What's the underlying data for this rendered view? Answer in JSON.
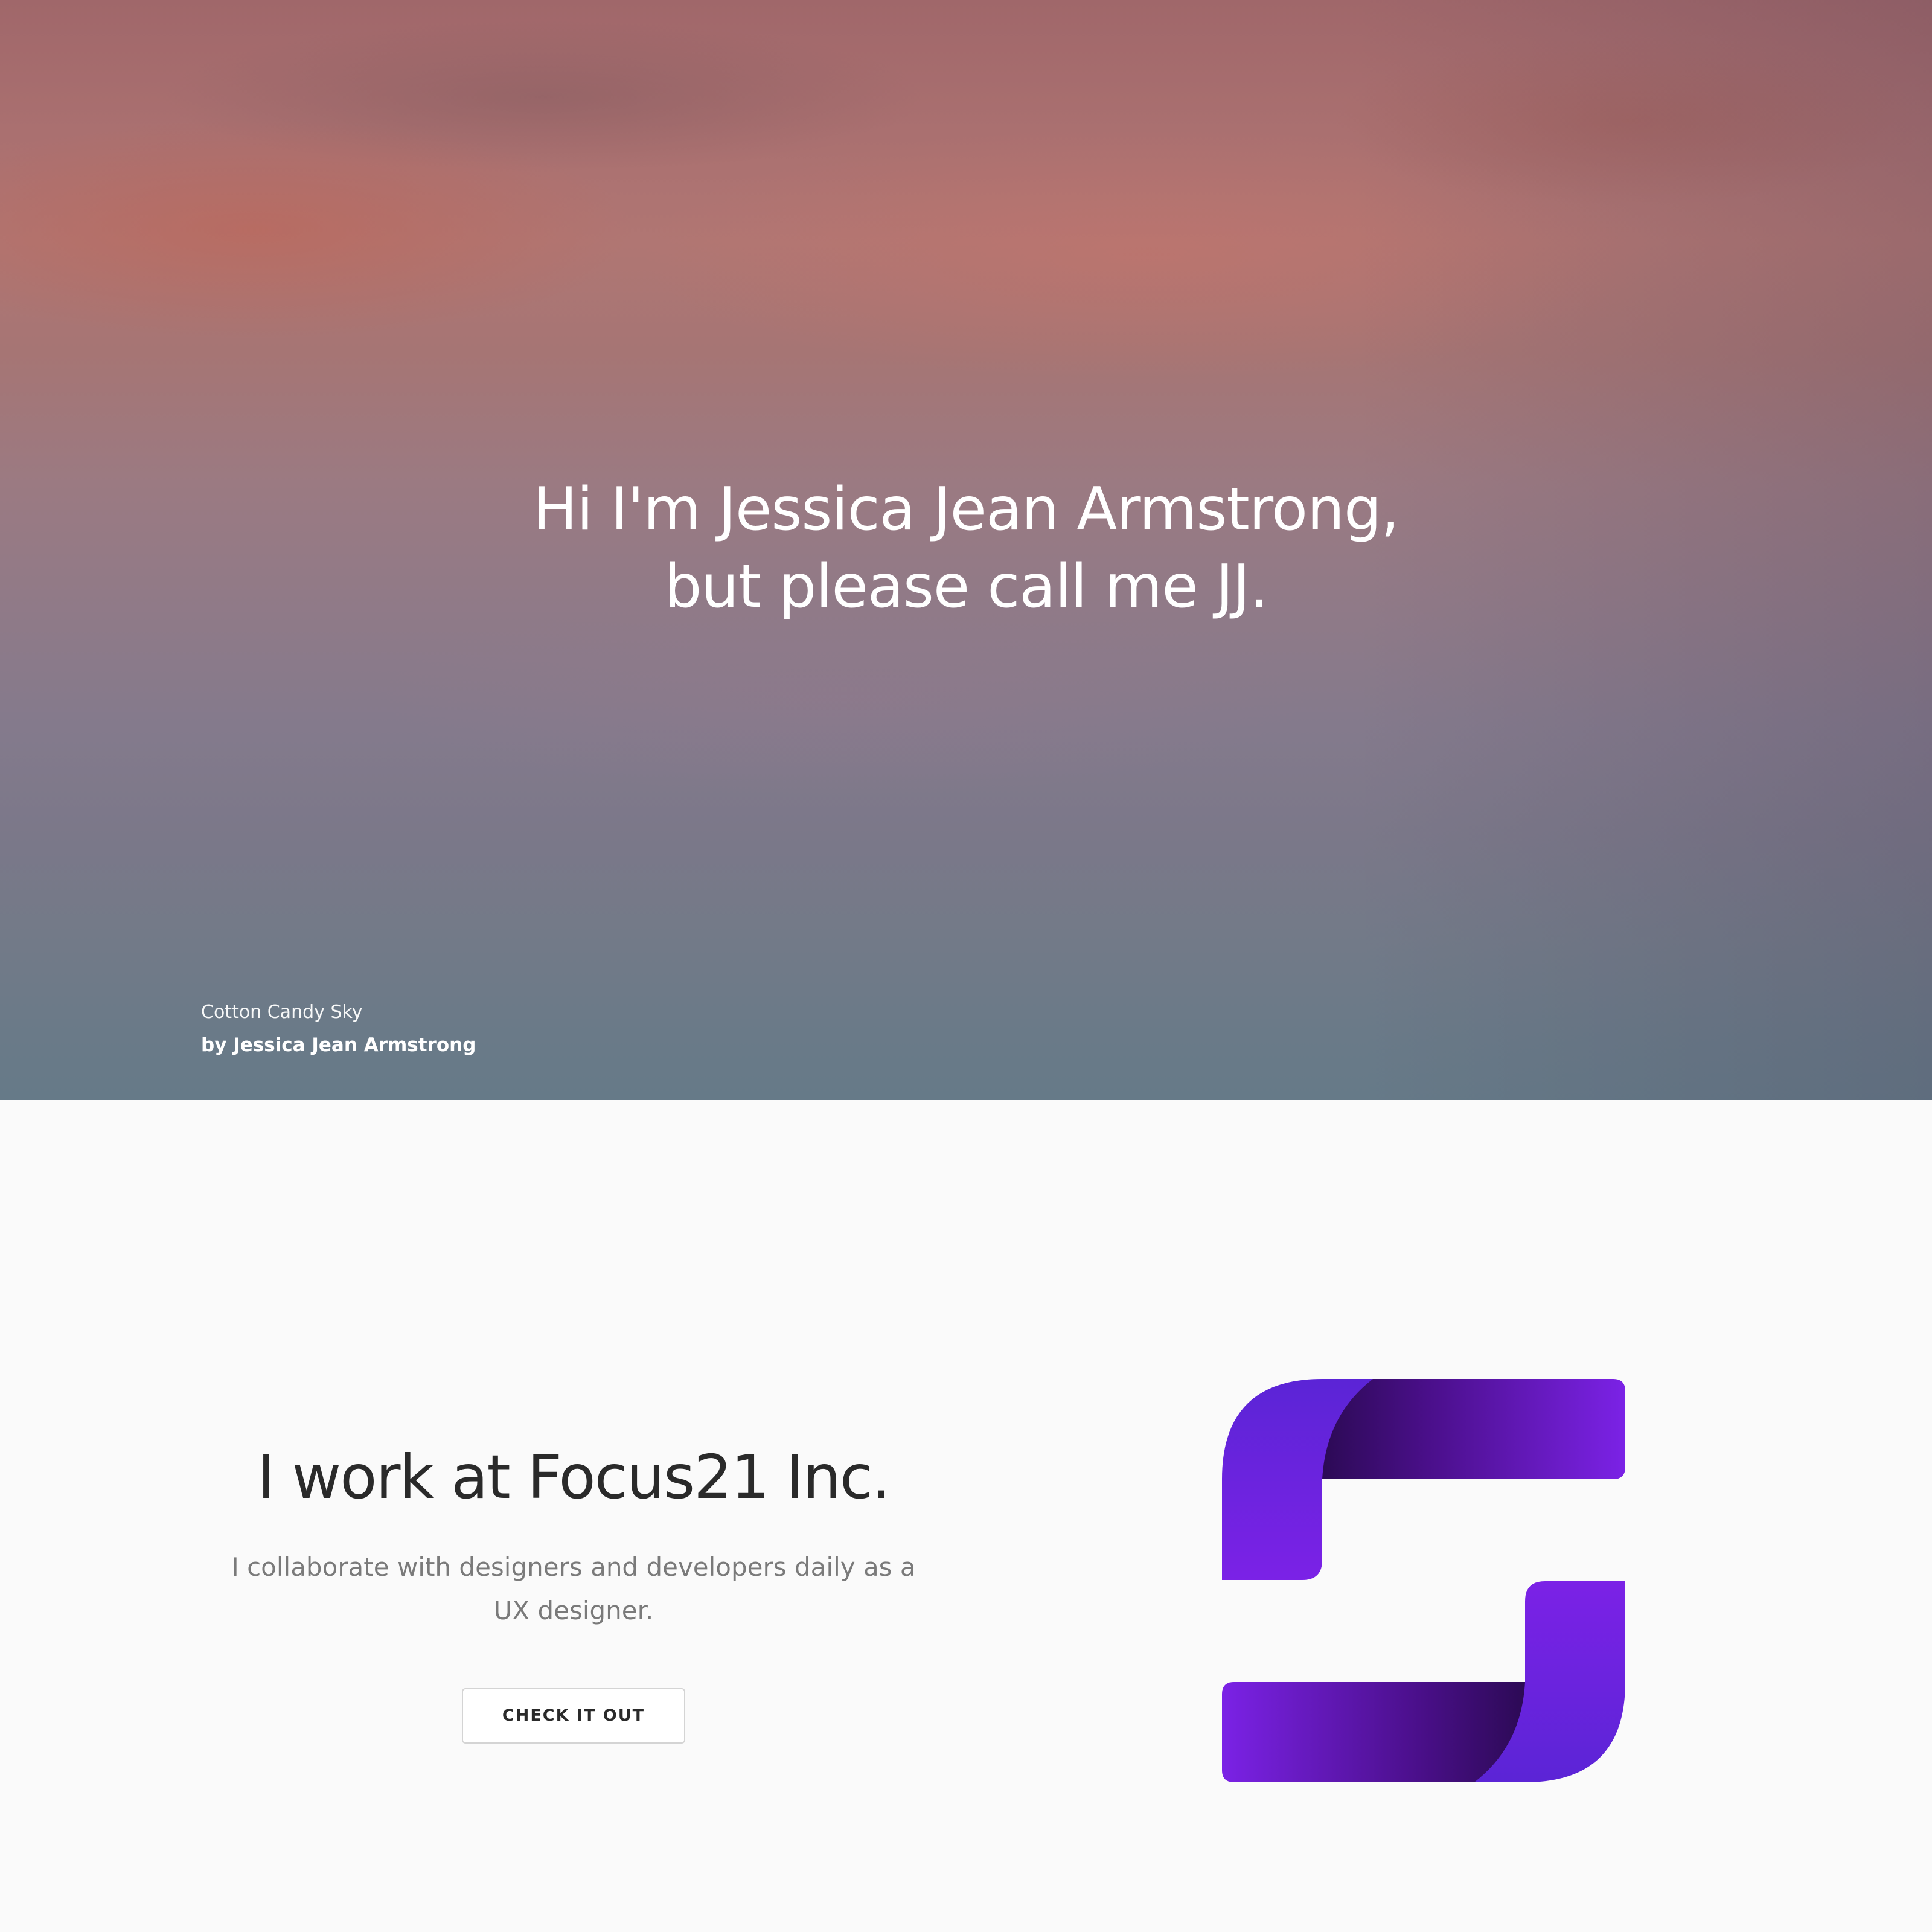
{
  "hero": {
    "title_line1": "Hi I'm Jessica Jean Armstrong,",
    "title_line2": "but please call me JJ.",
    "photo_title": "Cotton Candy Sky",
    "photo_author": "by Jessica Jean Armstrong"
  },
  "work": {
    "heading": "I work at Focus21 Inc.",
    "description": "I collaborate with designers and developers daily as a UX designer.",
    "cta_label": "CHECK IT OUT",
    "logo_icon": "focus21-logo-icon"
  },
  "colors": {
    "logo_light": "#7b22e6",
    "logo_mid": "#5b24d6",
    "logo_dark": "#2c0a55",
    "heading_text": "#2a2a2a",
    "body_text": "#7a7a7a"
  }
}
